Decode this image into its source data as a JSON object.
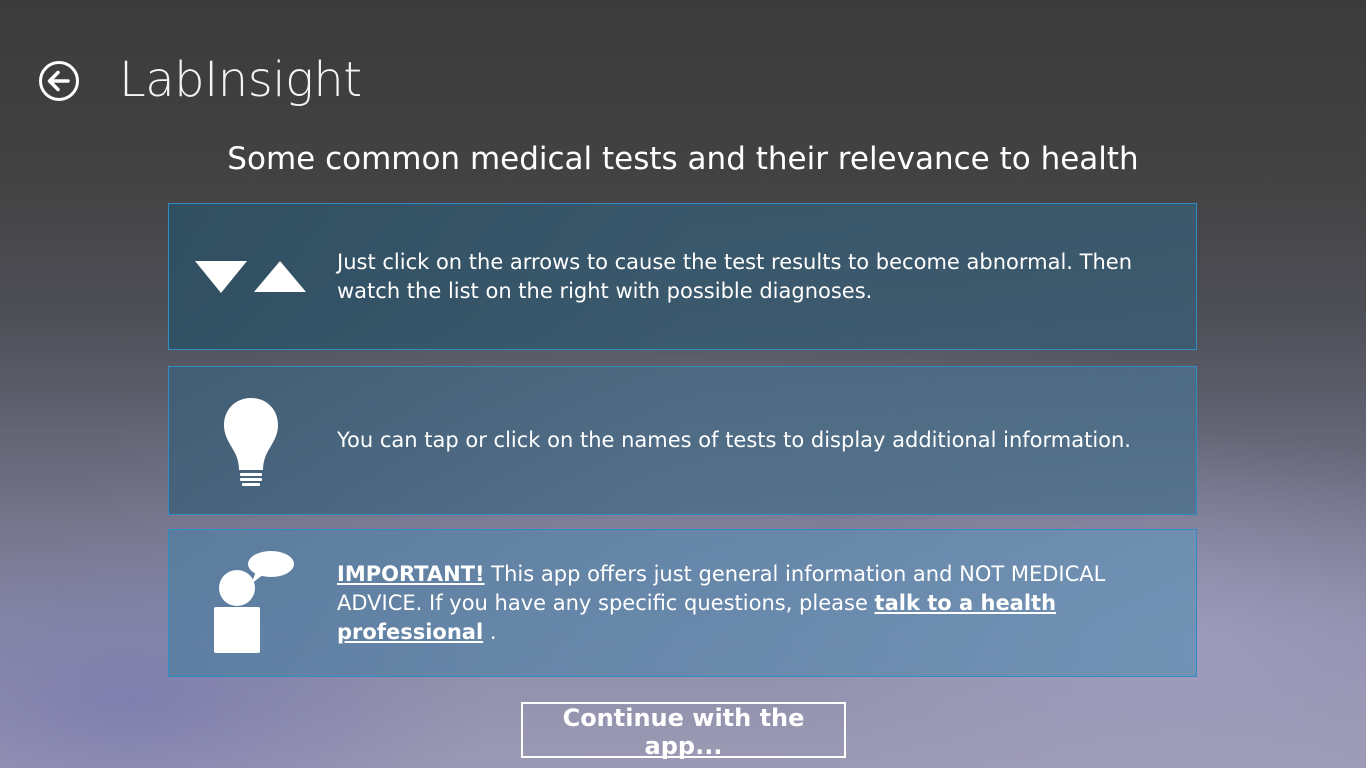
{
  "header": {
    "back_icon": "back-arrow-icon",
    "app_title": "LabInsight"
  },
  "page_heading": "Some common medical tests and their relevance to health",
  "cards": [
    {
      "icon": "up-down-arrows-icon",
      "text": "Just click on the arrows to cause the test results to become abnormal. Then watch the list on the right with possible diagnoses."
    },
    {
      "icon": "lightbulb-icon",
      "text": "You can tap or click on the names of tests to display additional information."
    },
    {
      "icon": "person-speech-bubble-icon",
      "important_label": "IMPORTANT!",
      "text_before_link": " This app offers just general information and NOT MEDICAL ADVICE. If you have any specific questions, please ",
      "link_label": "talk to a health professional",
      "text_after_link": " ."
    }
  ],
  "continue_button_label": "Continue with the app...",
  "colors": {
    "card_border": "#2f8cc4",
    "text": "#ffffff",
    "background_top": "#3b3b3b"
  }
}
